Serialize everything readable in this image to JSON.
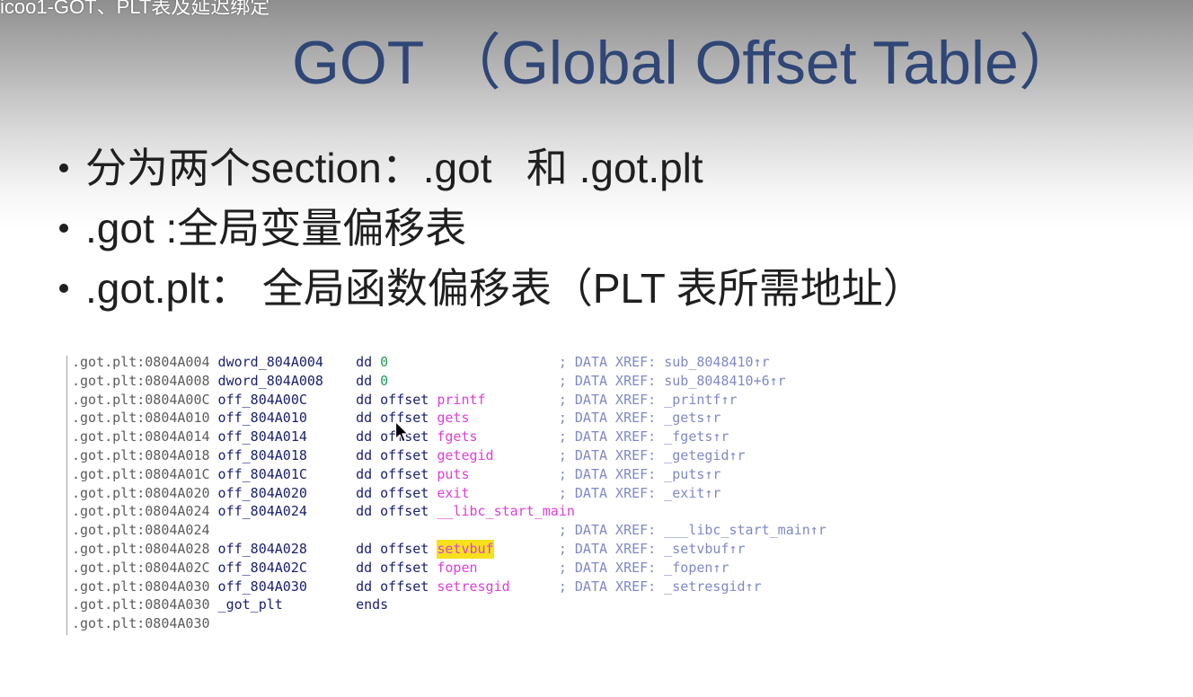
{
  "video": {
    "title": "icoo1-GOT、PLT表及延迟绑定"
  },
  "slide": {
    "title": "GOT （Global Offset Table）",
    "bullets": [
      "分为两个section：.got   和 .got.plt",
      ".got :全局变量偏移表",
      ".got.plt： 全局函数偏移表（PLT 表所需地址）"
    ]
  },
  "listing": {
    "rows": [
      {
        "address": ".got.plt:0804A004",
        "label": "dword_804A004",
        "directive": "dd",
        "operand": "0",
        "comment": "; DATA XREF: sub_8048410↑r"
      },
      {
        "address": ".got.plt:0804A008",
        "label": "dword_804A008",
        "directive": "dd",
        "operand": "0",
        "comment": "; DATA XREF: sub_8048410+6↑r"
      },
      {
        "address": ".got.plt:0804A00C",
        "label": "off_804A00C",
        "directive": "dd offset",
        "operand": "printf",
        "comment": "; DATA XREF: _printf↑r"
      },
      {
        "address": ".got.plt:0804A010",
        "label": "off_804A010",
        "directive": "dd offset",
        "operand": "gets",
        "comment": "; DATA XREF: _gets↑r"
      },
      {
        "address": ".got.plt:0804A014",
        "label": "off_804A014",
        "directive": "dd offset",
        "operand": "fgets",
        "comment": "; DATA XREF: _fgets↑r"
      },
      {
        "address": ".got.plt:0804A018",
        "label": "off_804A018",
        "directive": "dd offset",
        "operand": "getegid",
        "comment": "; DATA XREF: _getegid↑r"
      },
      {
        "address": ".got.plt:0804A01C",
        "label": "off_804A01C",
        "directive": "dd offset",
        "operand": "puts",
        "comment": "; DATA XREF: _puts↑r"
      },
      {
        "address": ".got.plt:0804A020",
        "label": "off_804A020",
        "directive": "dd offset",
        "operand": "exit",
        "comment": "; DATA XREF: _exit↑r"
      },
      {
        "address": ".got.plt:0804A024",
        "label": "off_804A024",
        "directive": "dd offset",
        "operand": "__libc_start_main"
      },
      {
        "address": ".got.plt:0804A024",
        "comment": "; DATA XREF: ___libc_start_main↑r"
      },
      {
        "address": ".got.plt:0804A028",
        "label": "off_804A028",
        "directive": "dd offset",
        "operand": "setvbuf",
        "comment": "; DATA XREF: _setvbuf↑r"
      },
      {
        "address": ".got.plt:0804A02C",
        "label": "off_804A02C",
        "directive": "dd offset",
        "operand": "fopen",
        "comment": "; DATA XREF: _fopen↑r"
      },
      {
        "address": ".got.plt:0804A030",
        "label": "off_804A030",
        "directive": "dd offset",
        "operand": "setresgid",
        "comment": "; DATA XREF: _setresgid↑r"
      },
      {
        "address": ".got.plt:0804A030",
        "label": "_got_plt",
        "directive": "ends"
      },
      {
        "address": ".got.plt:0804A030"
      }
    ]
  },
  "icons": {
    "bullet": "bullet-dot",
    "cursor": "mouse-pointer"
  },
  "colors": {
    "title": "#2f4676",
    "text": "#1f1f1f",
    "address": "#5c5c5c",
    "name": "#1b216f",
    "symbol": "#dc3fd8",
    "number": "#22995a",
    "comment": "#8089c3",
    "highlight": "#f7e11c"
  }
}
